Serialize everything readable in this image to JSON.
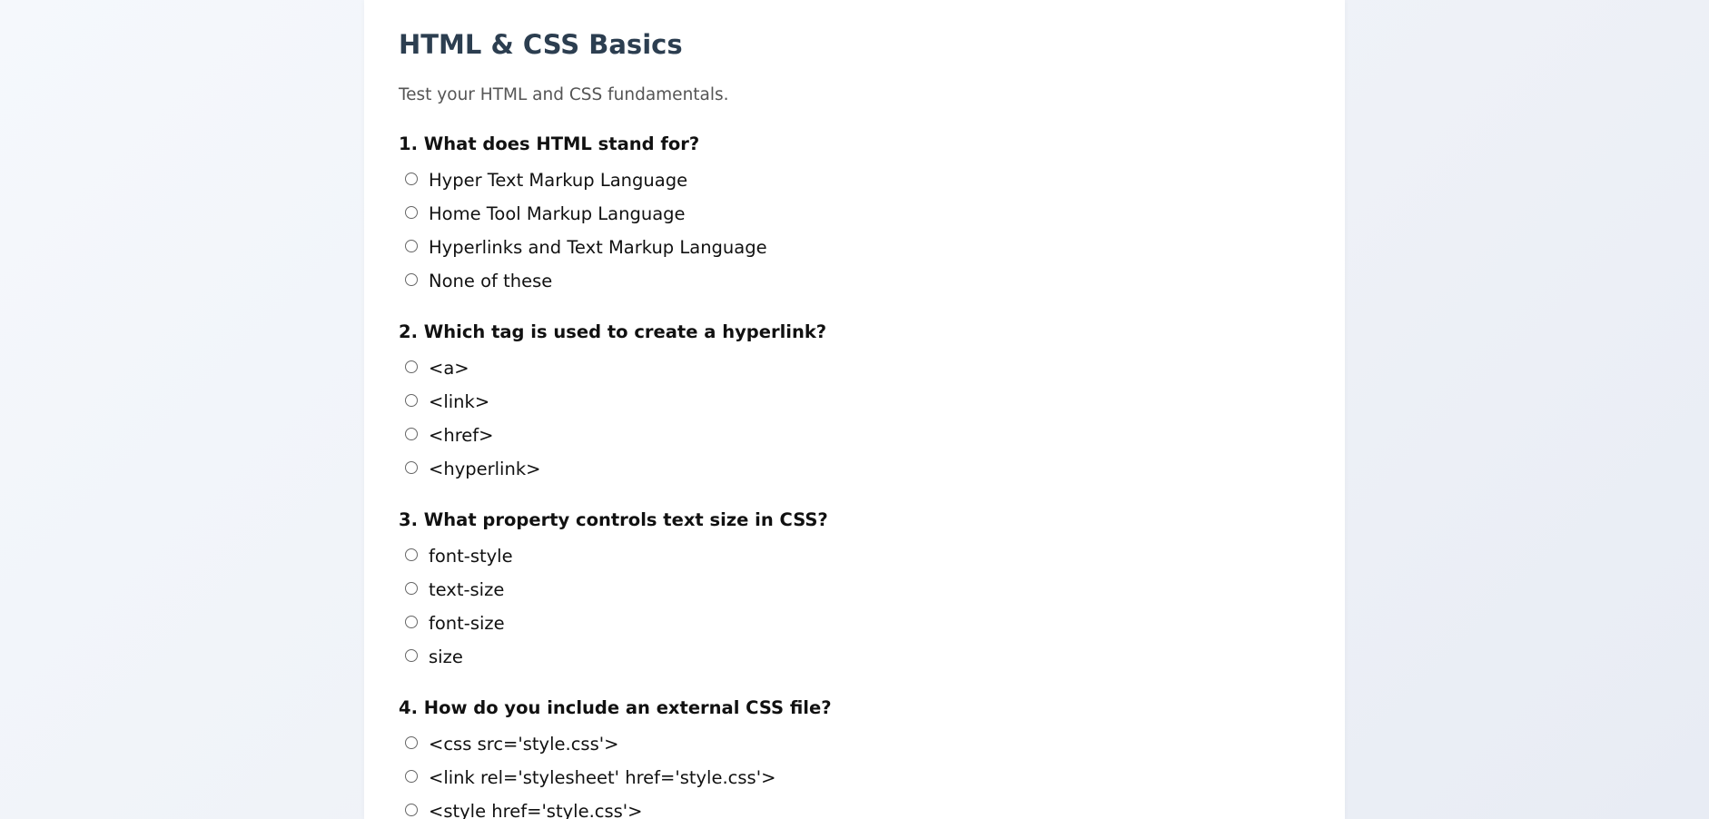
{
  "quiz": {
    "title": "HTML & CSS Basics",
    "subtitle": "Test your HTML and CSS fundamentals."
  },
  "questions": [
    {
      "text": "1. What does HTML stand for?",
      "options": [
        "Hyper Text Markup Language",
        "Home Tool Markup Language",
        "Hyperlinks and Text Markup Language",
        "None of these"
      ]
    },
    {
      "text": "2. Which tag is used to create a hyperlink?",
      "options": [
        "<a>",
        "<link>",
        "<href>",
        "<hyperlink>"
      ]
    },
    {
      "text": "3. What property controls text size in CSS?",
      "options": [
        "font-style",
        "text-size",
        "font-size",
        "size"
      ]
    },
    {
      "text": "4. How do you include an external CSS file?",
      "options": [
        "<css src='style.css'>",
        "<link rel='stylesheet' href='style.css'>",
        "<style href='style.css'>"
      ]
    }
  ]
}
